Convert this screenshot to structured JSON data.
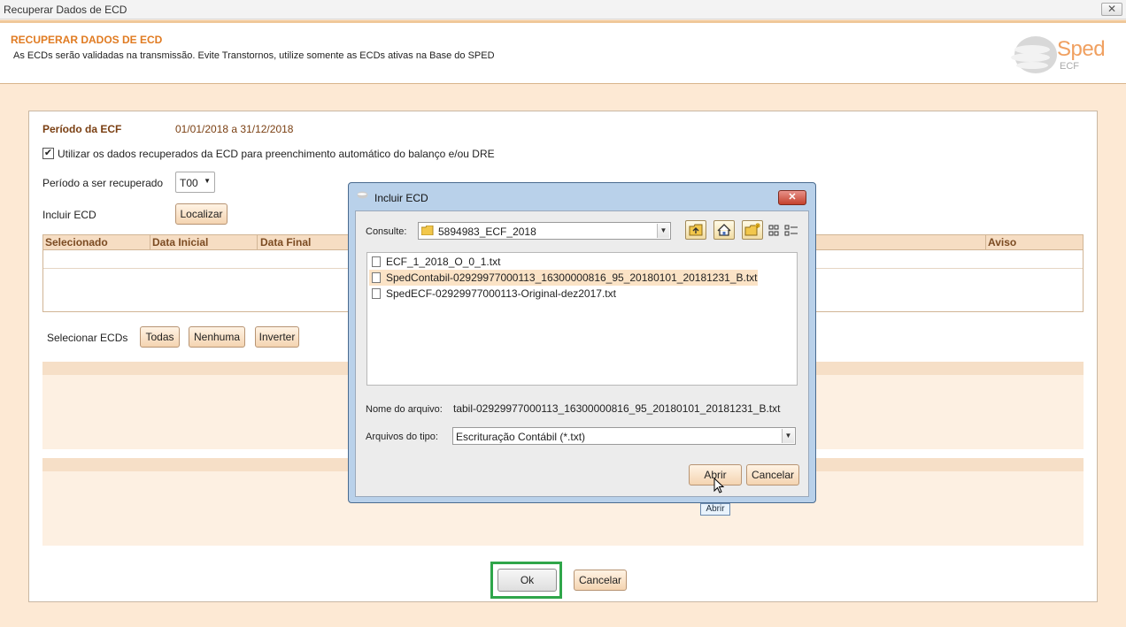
{
  "window": {
    "title": "Recuperar Dados de ECD",
    "close_glyph": "✕"
  },
  "header": {
    "title": "RECUPERAR DADOS DE ECD",
    "subtitle": "As ECDs serão validadas na transmissão. Evite Transtornos, utilize somente as ECDs ativas na Base do SPED",
    "logo_text": "Sped",
    "logo_sub": "ECF"
  },
  "form": {
    "periodo_label": "Período da ECF",
    "periodo_value": "01/01/2018 a 31/12/2018",
    "checkbox_label": "Utilizar os dados recuperados da ECD para preenchimento automático do balanço e/ou DRE",
    "checkbox_checked": "✔",
    "periodo_recuperar_label": "Período a ser recuperado",
    "periodo_recuperar_value": "T00",
    "incluir_label": "Incluir ECD",
    "localizar_button": "Localizar"
  },
  "table": {
    "columns": [
      "Selecionado",
      "Data Inicial",
      "Data Final",
      "Aviso"
    ]
  },
  "selection": {
    "label": "Selecionar ECDs",
    "todas": "Todas",
    "nenhuma": "Nenhuma",
    "inverter": "Inverter"
  },
  "footer": {
    "ok": "Ok",
    "cancelar": "Cancelar"
  },
  "dialog": {
    "title": "Incluir ECD",
    "close_glyph": "✕",
    "consulte_label": "Consulte:",
    "folder": "5894983_ECF_2018",
    "files": [
      "ECF_1_2018_O_0_1.txt",
      "SpedContabil-02929977000113_16300000816_95_20180101_20181231_B.txt",
      "SpedECF-02929977000113-Original-dez2017.txt"
    ],
    "selected_index": 1,
    "filename_label": "Nome do arquivo:",
    "filename_value": "tabil-02929977000113_16300000816_95_20180101_20181231_B.txt",
    "filetype_label": "Arquivos do tipo:",
    "filetype_value": "Escrituração Contábil (*.txt)",
    "open_button": "Abrir",
    "cancel_button": "Cancelar",
    "tooltip": "Abrir"
  },
  "colors": {
    "accent": "#e07b22",
    "panel_bg": "#fde9d4",
    "highlight": "#2fa64a"
  }
}
